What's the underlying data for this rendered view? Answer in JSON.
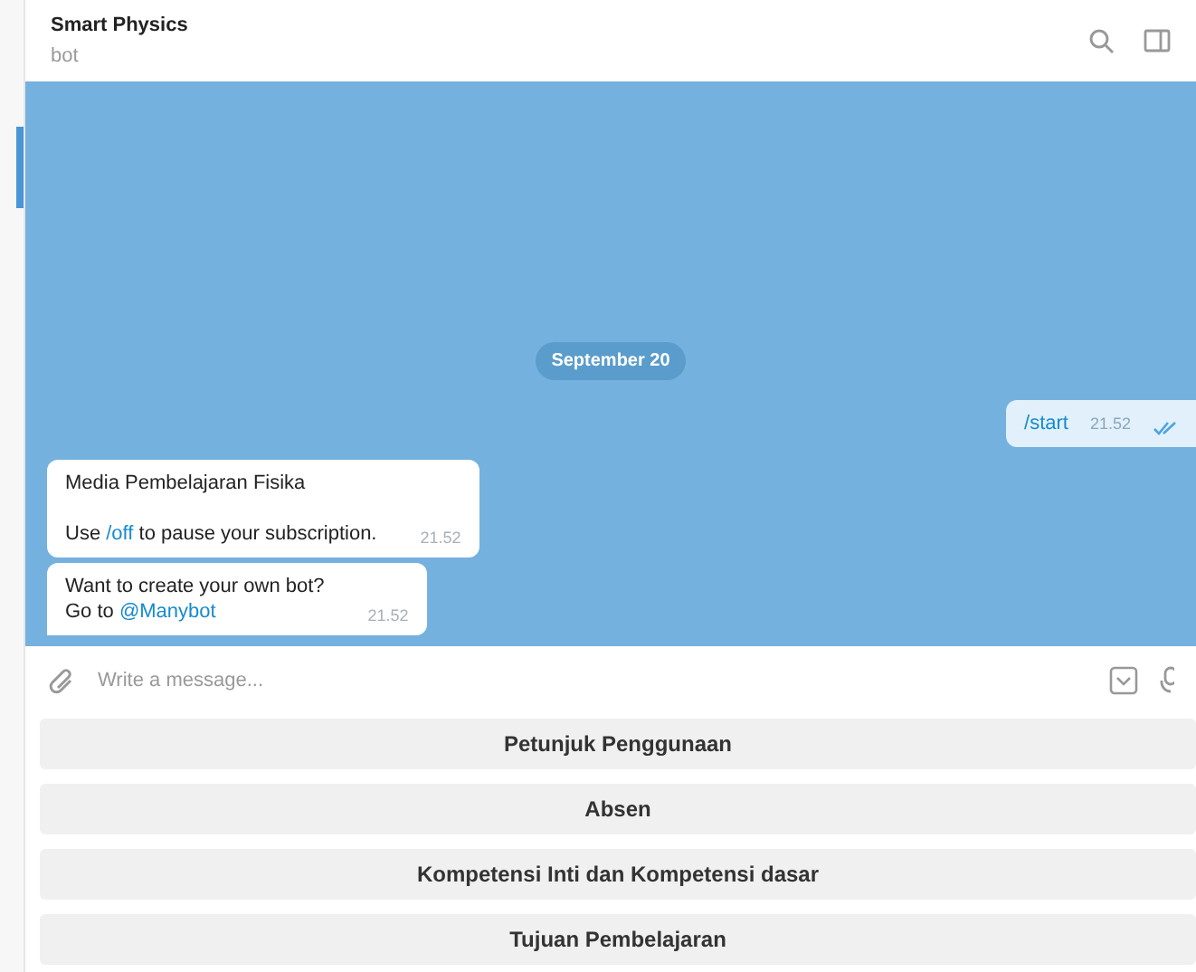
{
  "header": {
    "title": "Smart Physics",
    "subtitle": "bot"
  },
  "date_badge": "September 20",
  "messages": [
    {
      "kind": "outgoing",
      "paragraphs": [
        [
          {
            "kind": "command",
            "text": "/start"
          }
        ]
      ],
      "time": "21.52",
      "read": true
    },
    {
      "kind": "incoming",
      "paragraphs": [
        [
          {
            "kind": "plain",
            "text": "Media Pembelajaran Fisika"
          }
        ],
        [
          {
            "kind": "plain",
            "text": "Use "
          },
          {
            "kind": "link",
            "text": "/off"
          },
          {
            "kind": "plain",
            "text": " to pause your subscription."
          }
        ]
      ],
      "time": "21.52",
      "tail": false,
      "tight": false
    },
    {
      "kind": "incoming",
      "paragraphs": [
        [
          {
            "kind": "plain",
            "text": "Want to create your own bot?"
          }
        ],
        [
          {
            "kind": "plain",
            "text": "Go to "
          },
          {
            "kind": "link",
            "text": "@Manybot"
          }
        ]
      ],
      "time": "21.52",
      "tail": true,
      "tight": true
    }
  ],
  "composer": {
    "placeholder": "Write a message..."
  },
  "keyboard": [
    "Petunjuk Penggunaan",
    "Absen",
    "Kompetensi Inti dan Kompetensi dasar",
    "Tujuan Pembelajaran"
  ]
}
